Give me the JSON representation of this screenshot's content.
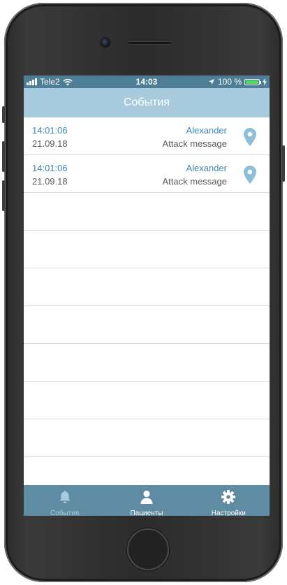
{
  "status_bar": {
    "carrier": "Tele2",
    "time": "14:03",
    "battery_percent": "100 %"
  },
  "nav": {
    "title": "События"
  },
  "events": [
    {
      "time": "14:01:06",
      "date": "21.09.18",
      "name": "Alexander",
      "message": "Attack message"
    },
    {
      "time": "14:01:06",
      "date": "21.09.18",
      "name": "Alexander",
      "message": "Attack message"
    }
  ],
  "tabs": [
    {
      "label": "События",
      "icon": "bell-icon",
      "active": true
    },
    {
      "label": "Пациенты",
      "icon": "person-icon",
      "active": false
    },
    {
      "label": "Настройки",
      "icon": "gear-icon",
      "active": false
    }
  ],
  "colors": {
    "status_bar": "#4e7e95",
    "nav_bar": "#a7cbdd",
    "tab_bar": "#5f8ba3",
    "accent_text": "#3d86b4",
    "pin": "#8dbfd8"
  }
}
